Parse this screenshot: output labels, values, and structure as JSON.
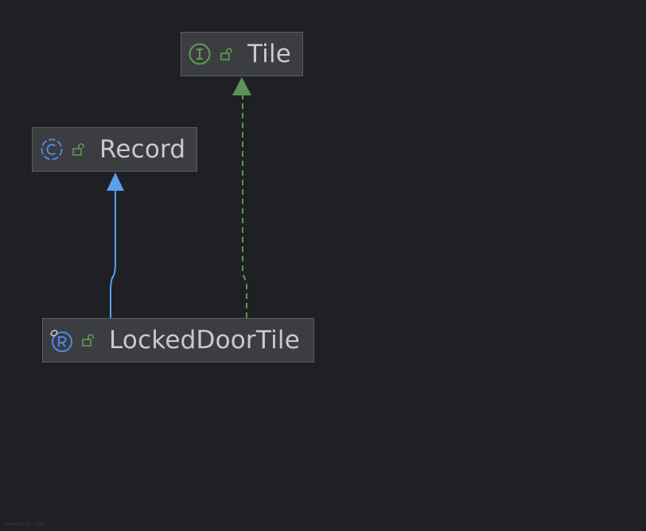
{
  "diagram": {
    "nodes": [
      {
        "id": "tile",
        "kind": "interface",
        "kind_letter": "I",
        "visibility": "public",
        "label": "Tile"
      },
      {
        "id": "record",
        "kind": "class",
        "kind_letter": "C",
        "visibility": "public",
        "label": "Record"
      },
      {
        "id": "locked",
        "kind": "record",
        "kind_letter": "R",
        "visibility": "public",
        "label": "LockedDoorTile"
      }
    ],
    "edges": [
      {
        "from": "locked",
        "to": "record",
        "relation": "extends",
        "style": "solid"
      },
      {
        "from": "locked",
        "to": "tile",
        "relation": "implements",
        "style": "dashed"
      }
    ]
  },
  "colors": {
    "background": "#1f2023",
    "node_fill": "#3b3d40",
    "node_border": "#5c5e62",
    "text": "#c8cacd",
    "extends_edge": "#5a9ef0",
    "implements_edge": "#5f9356",
    "interface_icon": "#5f9a56",
    "class_icon": "#4f86e8",
    "lock_icon": "#5f9a56"
  },
  "icons": {
    "interface": "interface-icon",
    "class": "class-icon",
    "record": "record-icon",
    "lock": "lock-open-icon"
  },
  "footer": {
    "text": "Powered by yFiles"
  }
}
